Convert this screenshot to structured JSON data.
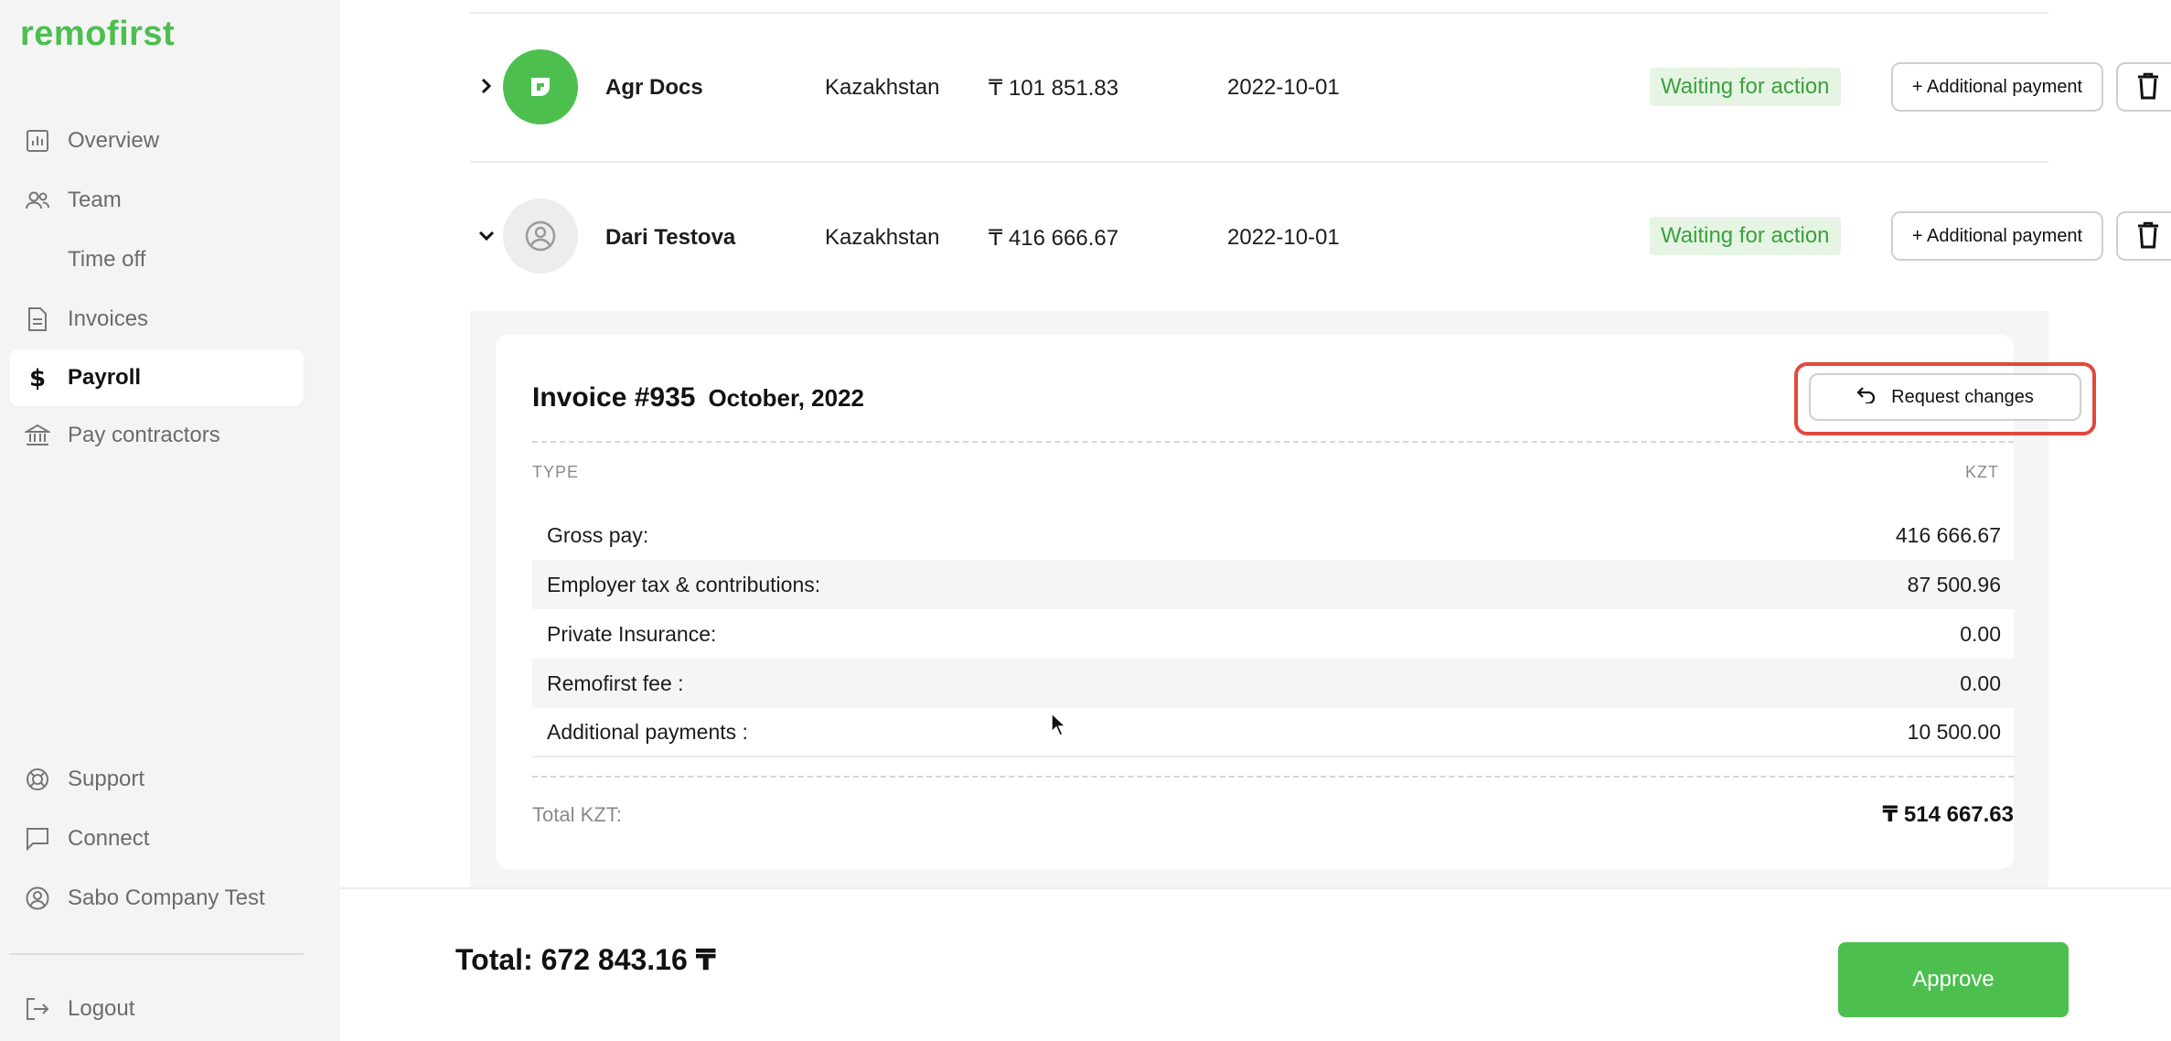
{
  "sidebar": {
    "logo": "remofirst",
    "items": [
      {
        "label": "Overview",
        "icon": "chart-icon"
      },
      {
        "label": "Team",
        "icon": "people-icon"
      },
      {
        "label": "Time off",
        "icon": ""
      },
      {
        "label": "Invoices",
        "icon": "document-icon"
      },
      {
        "label": "Payroll",
        "icon": "dollar-icon",
        "active": true
      },
      {
        "label": "Pay contractors",
        "icon": "bank-icon"
      }
    ],
    "bottom_items": [
      {
        "label": "Support",
        "icon": "lifebuoy-icon"
      },
      {
        "label": "Connect",
        "icon": "chat-icon"
      },
      {
        "label": "Sabo Company Test",
        "icon": "user-circle-icon"
      },
      {
        "label": "Logout",
        "icon": "logout-icon"
      }
    ]
  },
  "employees": [
    {
      "name": "Agr Docs",
      "country": "Kazakhstan",
      "amount": "₸ 101 851.83",
      "date": "2022-10-01",
      "status": "Waiting for action",
      "add_payment_label": "+ Additional payment",
      "expanded": false
    },
    {
      "name": "Dari Testova",
      "country": "Kazakhstan",
      "amount": "₸ 416 666.67",
      "date": "2022-10-01",
      "status": "Waiting for action",
      "add_payment_label": "+ Additional payment",
      "expanded": true
    }
  ],
  "invoice": {
    "number": "Invoice #935",
    "period": "October, 2022",
    "request_changes_label": "Request changes",
    "col_type": "TYPE",
    "col_currency": "KZT",
    "lines": [
      {
        "label": "Gross pay:",
        "value": "416 666.67"
      },
      {
        "label": "Employer tax & contributions:",
        "value": "87 500.96"
      },
      {
        "label": "Private Insurance:",
        "value": "0.00"
      },
      {
        "label": "Remofirst fee :",
        "value": "0.00"
      },
      {
        "label": "Additional payments :",
        "value": "10 500.00"
      }
    ],
    "total_label": "Total KZT:",
    "total_value": "₸ 514 667.63"
  },
  "footer": {
    "total": "Total: 672 843.16 ₸",
    "approve_label": "Approve"
  },
  "colors": {
    "brand_green": "#4cbf4f",
    "badge_bg": "#e6f4e4",
    "highlight_red": "#e2483c"
  }
}
